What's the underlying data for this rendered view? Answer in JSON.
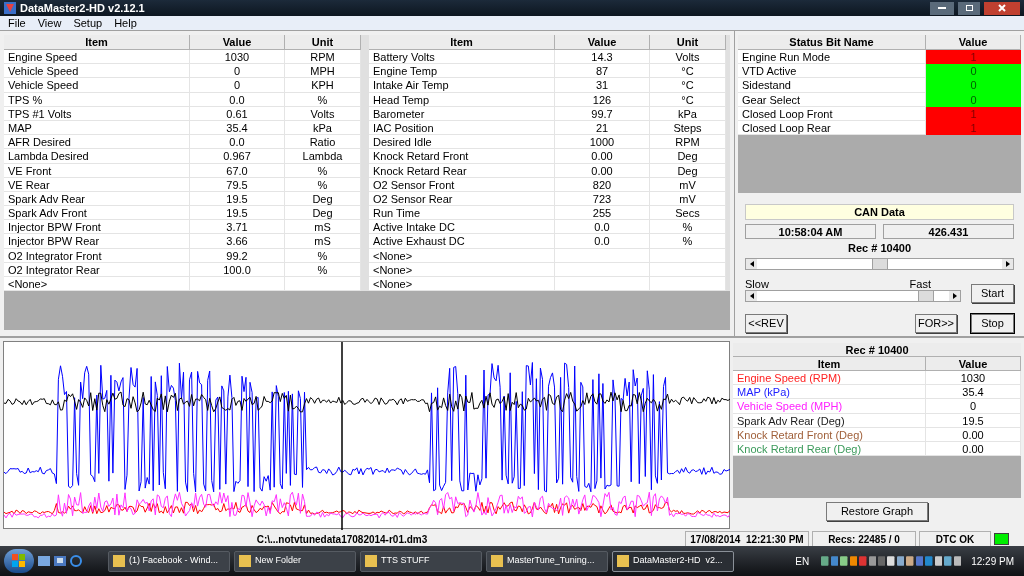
{
  "window": {
    "title": "DataMaster2-HD  v2.12.1"
  },
  "menu": [
    "File",
    "View",
    "Setup",
    "Help"
  ],
  "data_tables": [
    {
      "columns": [
        "Item",
        "Value",
        "Unit"
      ],
      "rows": [
        [
          "Engine Speed",
          "1030",
          "RPM"
        ],
        [
          "Vehicle Speed",
          "0",
          "MPH"
        ],
        [
          "Vehicle Speed",
          "0",
          "KPH"
        ],
        [
          "TPS %",
          "0.0",
          "%"
        ],
        [
          "TPS #1 Volts",
          "0.61",
          "Volts"
        ],
        [
          "MAP",
          "35.4",
          "kPa"
        ],
        [
          "AFR Desired",
          "0.0",
          "Ratio"
        ],
        [
          "Lambda Desired",
          "0.967",
          "Lambda"
        ],
        [
          "VE Front",
          "67.0",
          "%"
        ],
        [
          "VE Rear",
          "79.5",
          "%"
        ],
        [
          "Spark Adv Rear",
          "19.5",
          "Deg"
        ],
        [
          "Spark Adv Front",
          "19.5",
          "Deg"
        ],
        [
          "Injector BPW Front",
          "3.71",
          "mS"
        ],
        [
          "Injector BPW Rear",
          "3.66",
          "mS"
        ],
        [
          "O2 Integrator Front",
          "99.2",
          "%"
        ],
        [
          "O2 Integrator Rear",
          "100.0",
          "%"
        ],
        [
          "<None>",
          "",
          ""
        ]
      ]
    },
    {
      "columns": [
        "Item",
        "Value",
        "Unit"
      ],
      "rows": [
        [
          "Battery Volts",
          "14.3",
          "Volts"
        ],
        [
          "Engine Temp",
          "87",
          "°C"
        ],
        [
          "Intake Air Temp",
          "31",
          "°C"
        ],
        [
          "Head Temp",
          "126",
          "°C"
        ],
        [
          "Barometer",
          "99.7",
          "kPa"
        ],
        [
          "IAC Position",
          "21",
          "Steps"
        ],
        [
          "Desired Idle",
          "1000",
          "RPM"
        ],
        [
          "Knock Retard Front",
          "0.00",
          "Deg"
        ],
        [
          "Knock Retard Rear",
          "0.00",
          "Deg"
        ],
        [
          "O2 Sensor Front",
          "820",
          "mV"
        ],
        [
          "O2 Sensor Rear",
          "723",
          "mV"
        ],
        [
          "Run Time",
          "255",
          "Secs"
        ],
        [
          "Active Intake DC",
          "0.0",
          "%"
        ],
        [
          "Active Exhaust DC",
          "0.0",
          "%"
        ],
        [
          "<None>",
          "",
          ""
        ],
        [
          "<None>",
          "",
          ""
        ],
        [
          "<None>",
          "",
          ""
        ]
      ]
    }
  ],
  "status_bits": {
    "columns": [
      "Status Bit Name",
      "Value"
    ],
    "rows": [
      {
        "name": "Engine Run Mode",
        "value": "1",
        "on": true
      },
      {
        "name": "VTD Active",
        "value": "0",
        "on": false
      },
      {
        "name": "Sidestand",
        "value": "0",
        "on": false
      },
      {
        "name": "Gear Select",
        "value": "0",
        "on": false
      },
      {
        "name": "Closed Loop Front",
        "value": "1",
        "on": true
      },
      {
        "name": "Closed Loop Rear",
        "value": "1",
        "on": true
      }
    ]
  },
  "playback": {
    "title": "CAN Data",
    "time": "10:58:04 AM",
    "seconds": "426.431",
    "record": "Rec # 10400",
    "record_slider": {
      "level": 0.5
    },
    "speed_labels": [
      "Slow",
      "Fast"
    ],
    "speed_slider": {
      "level": 0.88
    },
    "buttons": [
      "Start",
      "<<REV",
      "FOR>>",
      "Stop"
    ]
  },
  "graph_table": {
    "title": "Rec # 10400",
    "columns": [
      "Item",
      "Value"
    ],
    "rows": [
      {
        "item": "Engine Speed (RPM)",
        "value": "1030",
        "color": "#ff2020"
      },
      {
        "item": "MAP (kPa)",
        "value": "35.4",
        "color": "#2020ff"
      },
      {
        "item": "Vehicle Speed (MPH)",
        "value": "0",
        "color": "#ff20ff"
      },
      {
        "item": "Spark Adv Rear (Deg)",
        "value": "19.5",
        "color": "#202020"
      },
      {
        "item": "Knock Retard Front (Deg)",
        "value": "0.00",
        "color": "#a0603a"
      },
      {
        "item": "Knock Retard Rear (Deg)",
        "value": "0.00",
        "color": "#3a9a5a"
      }
    ],
    "button": "Restore Graph"
  },
  "status_bar": {
    "file": "C:\\...notvtunedata17082014-r01.dm3",
    "datetime": "17/08/2014  12:21:30 PM",
    "records": "Recs: 22485 / 0",
    "dtc": "DTC OK",
    "dtc_ok": true
  },
  "taskbar": {
    "items": [
      {
        "label": "(1) Facebook - Wind...",
        "selected": false
      },
      {
        "label": "New Folder",
        "selected": false
      },
      {
        "label": "TTS STUFF",
        "selected": false
      },
      {
        "label": "MasterTune_Tuning...",
        "selected": false
      },
      {
        "label": "DataMaster2-HD  v2...",
        "selected": true
      }
    ],
    "language": "EN",
    "clock": "12:29 PM"
  }
}
